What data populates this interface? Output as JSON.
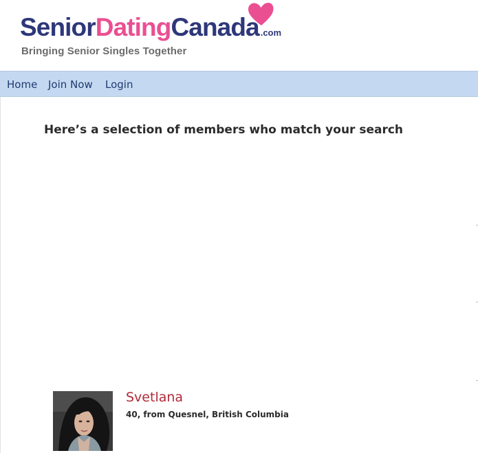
{
  "logo": {
    "word_senior": "Senior",
    "word_dating": "Dating",
    "word_canada": "Canada",
    "word_com": ".com",
    "tagline": "Bringing Senior Singles Together",
    "colors": {
      "navy": "#2e3779",
      "pink": "#ea4f92",
      "tagline_gray": "#6b6b6b"
    },
    "icon": "heart-icon"
  },
  "nav": {
    "background": "#c4d9f1",
    "items": [
      {
        "label": "Home"
      },
      {
        "label": "Join Now"
      },
      {
        "label": "Login"
      }
    ]
  },
  "main": {
    "heading": "Here’s a selection of members who match your search",
    "members": [
      {
        "name": "Svetlana",
        "details": "40, from Quesnel, British Columbia",
        "photo": "member-photo",
        "name_color": "#b02a37"
      }
    ]
  }
}
